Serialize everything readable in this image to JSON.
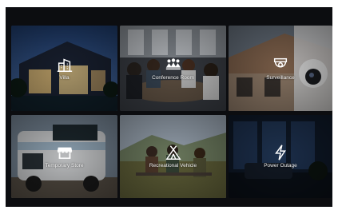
{
  "scenarios": [
    {
      "label": "Villa",
      "icon": "villa-icon"
    },
    {
      "label": "Conference Room",
      "icon": "conference-people-icon"
    },
    {
      "label": "Surveillance",
      "icon": "surveillance-camera-icon"
    },
    {
      "label": "Temporary Store",
      "icon": "store-awning-icon"
    },
    {
      "label": "Recreational Vehicle",
      "icon": "tent-icon"
    },
    {
      "label": "Power Outage",
      "icon": "lightning-icon"
    }
  ]
}
